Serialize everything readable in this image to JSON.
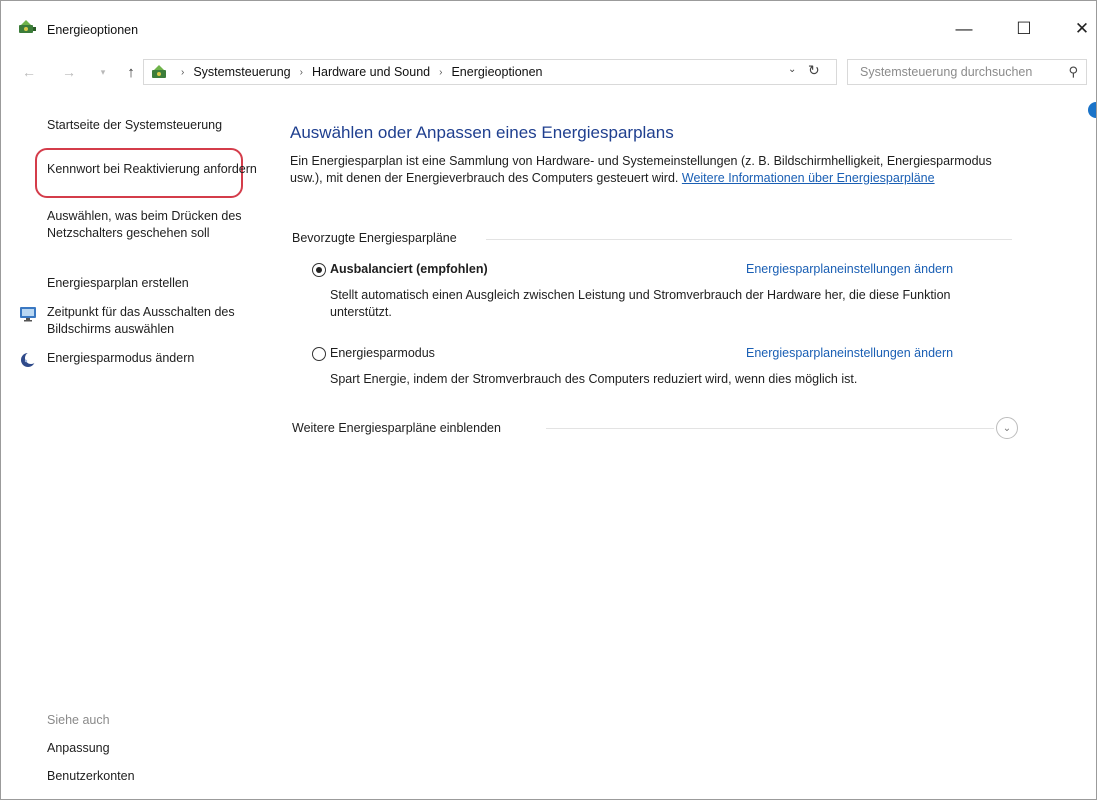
{
  "window": {
    "title": "Energieoptionen",
    "minimize_glyph": "—",
    "maximize_glyph": "☐",
    "close_glyph": "✕"
  },
  "nav": {
    "back_glyph": "←",
    "forward_glyph": "→",
    "recent_glyph": "▾",
    "up_glyph": "↑",
    "breadcrumbs": [
      "Systemsteuerung",
      "Hardware und Sound",
      "Energieoptionen"
    ],
    "separator": "›",
    "dropdown_glyph": "⌄",
    "refresh_glyph": "↻",
    "search_placeholder": "Systemsteuerung durchsuchen",
    "search_glyph": "⚲"
  },
  "sidebar": {
    "items": [
      {
        "label": "Startseite der Systemsteuerung"
      },
      {
        "label": "Kennwort bei Reaktivierung anfordern",
        "highlighted": true
      },
      {
        "label": "Auswählen, was beim Drücken des Netzschalters geschehen soll"
      },
      {
        "label": "Energiesparplan erstellen"
      },
      {
        "label": "Zeitpunkt für das Ausschalten des Bildschirms auswählen",
        "icon": "monitor-icon"
      },
      {
        "label": "Energiesparmodus ändern",
        "icon": "moon-icon"
      }
    ],
    "see_also_title": "Siehe auch",
    "see_also": [
      "Anpassung",
      "Benutzerkonten"
    ],
    "highlight_color": "#d43c4a"
  },
  "main": {
    "heading": "Auswählen oder Anpassen eines Energiesparplans",
    "intro_text": "Ein Energiesparplan ist eine Sammlung von Hardware- und Systemeinstellungen (z. B. Bildschirmhelligkeit, Energiesparmodus usw.), mit denen der Energieverbrauch des Computers gesteuert wird.",
    "intro_link": "Weitere Informationen über Energiesparpläne",
    "group_title": "Bevorzugte Energiesparpläne",
    "plans": [
      {
        "name": "Ausbalanciert (empfohlen)",
        "selected": true,
        "link": "Energiesparplaneinstellungen ändern",
        "description": "Stellt automatisch einen Ausgleich zwischen Leistung und Stromverbrauch der Hardware her, die diese Funktion unterstützt."
      },
      {
        "name": "Energiesparmodus",
        "selected": false,
        "link": "Energiesparplaneinstellungen ändern",
        "description": "Spart Energie, indem der Stromverbrauch des Computers reduziert wird, wenn dies möglich ist."
      }
    ],
    "more_plans_label": "Weitere Energiesparpläne einblenden",
    "expand_glyph": "⌄"
  },
  "colors": {
    "heading": "#1f3f8f",
    "link": "#1a5fb4",
    "help_dot": "#1a73c8"
  }
}
